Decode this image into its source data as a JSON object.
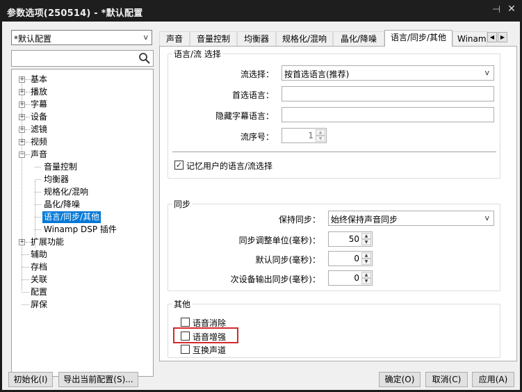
{
  "window": {
    "title": "参数选项(250514) - *默认配置",
    "pin_glyph": "⊣",
    "close_glyph": "✕"
  },
  "left": {
    "preset_value": "*默认配置",
    "preset_arrow": "v",
    "search_placeholder": "",
    "tree": [
      {
        "label": "基本",
        "expander": "+"
      },
      {
        "label": "播放",
        "expander": "+"
      },
      {
        "label": "字幕",
        "expander": "+"
      },
      {
        "label": "设备",
        "expander": "+"
      },
      {
        "label": "滤镜",
        "expander": "+"
      },
      {
        "label": "视频",
        "expander": "+"
      },
      {
        "label": "声音",
        "expander": "−"
      },
      {
        "label": "音量控制",
        "expander": ""
      },
      {
        "label": "均衡器",
        "expander": ""
      },
      {
        "label": "规格化/混响",
        "expander": ""
      },
      {
        "label": "晶化/降噪",
        "expander": ""
      },
      {
        "label": "语言/同步/其他",
        "expander": ""
      },
      {
        "label": "Winamp DSP 插件",
        "expander": ""
      },
      {
        "label": "扩展功能",
        "expander": "+"
      },
      {
        "label": "辅助",
        "expander": ""
      },
      {
        "label": "存档",
        "expander": ""
      },
      {
        "label": "关联",
        "expander": ""
      },
      {
        "label": "配置",
        "expander": ""
      },
      {
        "label": "屏保",
        "expander": ""
      }
    ]
  },
  "tabs": [
    "声音",
    "音量控制",
    "均衡器",
    "规格化/混响",
    "晶化/降噪",
    "语言/同步/其他",
    "Winam"
  ],
  "tab_scroll": {
    "left": "◀",
    "right": "▶"
  },
  "lang_group": {
    "title": "语言/流 选择",
    "stream_select_label": "流选择：",
    "stream_select_value": "按首选语言(推荐)",
    "preferred_lang_label": "首选语言：",
    "preferred_lang_value": "",
    "hidden_sub_label": "隐藏字幕语言：",
    "hidden_sub_value": "",
    "stream_no_label": "流序号：",
    "stream_no_value": "1",
    "remember_label": "记忆用户的语言/流选择",
    "remember_checked": true
  },
  "sync_group": {
    "title": "同步",
    "keep_sync_label": "保持同步：",
    "keep_sync_value": "始终保持声音同步",
    "adjust_unit_label": "同步调整单位(毫秒)：",
    "adjust_unit_value": "50",
    "default_sync_label": "默认同步(毫秒)：",
    "default_sync_value": "0",
    "secondary_sync_label": "次设备输出同步(毫秒)：",
    "secondary_sync_value": "0"
  },
  "other_group": {
    "title": "其他",
    "items": [
      {
        "label": "语音消除",
        "checked": false
      },
      {
        "label": "语音增强",
        "checked": false
      },
      {
        "label": "互换声道",
        "checked": false
      }
    ]
  },
  "glyphs": {
    "arrow": "v",
    "spin_up": "▲",
    "spin_down": "▼",
    "check": "✓"
  },
  "footer": {
    "init_label": "初始化(I)",
    "export_label": "导出当前配置(S)...",
    "ok_label": "确定(O)",
    "cancel_label": "取消(C)",
    "apply_label": "应用(A)"
  },
  "colors": {
    "selection": "#0078d7",
    "highlight_box": "#d62828",
    "title_bg": "#1e1e1e"
  }
}
